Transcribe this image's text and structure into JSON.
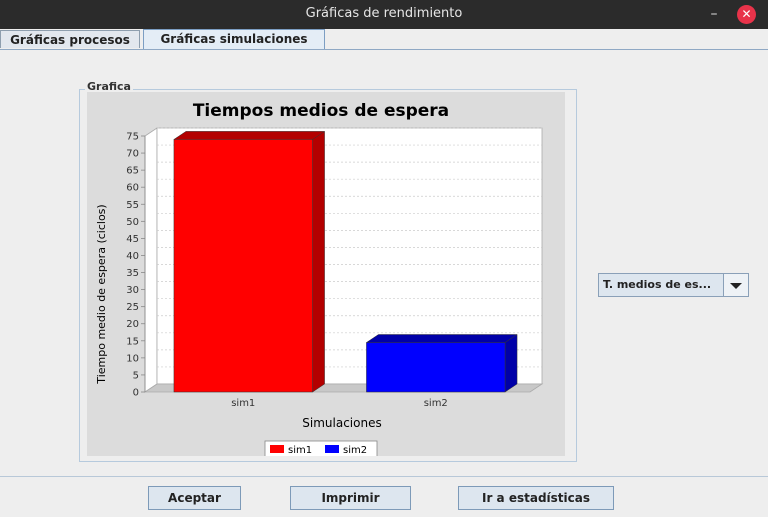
{
  "window": {
    "title": "Gráficas de rendimiento",
    "minimize_glyph": "–",
    "close_glyph": "✕"
  },
  "tabs": [
    {
      "label": "Gráficas procesos",
      "active": false
    },
    {
      "label": "Gráficas simulaciones",
      "active": true
    }
  ],
  "group": {
    "label": "Grafica"
  },
  "dropdown": {
    "selected": "T. medios de es..."
  },
  "buttons": {
    "accept": "Aceptar",
    "print": "Imprimir",
    "stats": "Ir a estadísticas"
  },
  "colors": {
    "series1": "#ff0000",
    "series2": "#0000ff"
  },
  "chart_data": {
    "type": "bar",
    "title": "Tiempos medios de espera",
    "xlabel": "Simulaciones",
    "ylabel": "Tiempo medio de espera (ciclos)",
    "categories": [
      "sim1",
      "sim2"
    ],
    "values": [
      74,
      14.5
    ],
    "ylim": [
      0,
      75
    ],
    "yticks": [
      0,
      5,
      10,
      15,
      20,
      25,
      30,
      35,
      40,
      45,
      50,
      55,
      60,
      65,
      70,
      75
    ],
    "legend": [
      "sim1",
      "sim2"
    ],
    "legend_position": "bottom",
    "grid": true
  }
}
